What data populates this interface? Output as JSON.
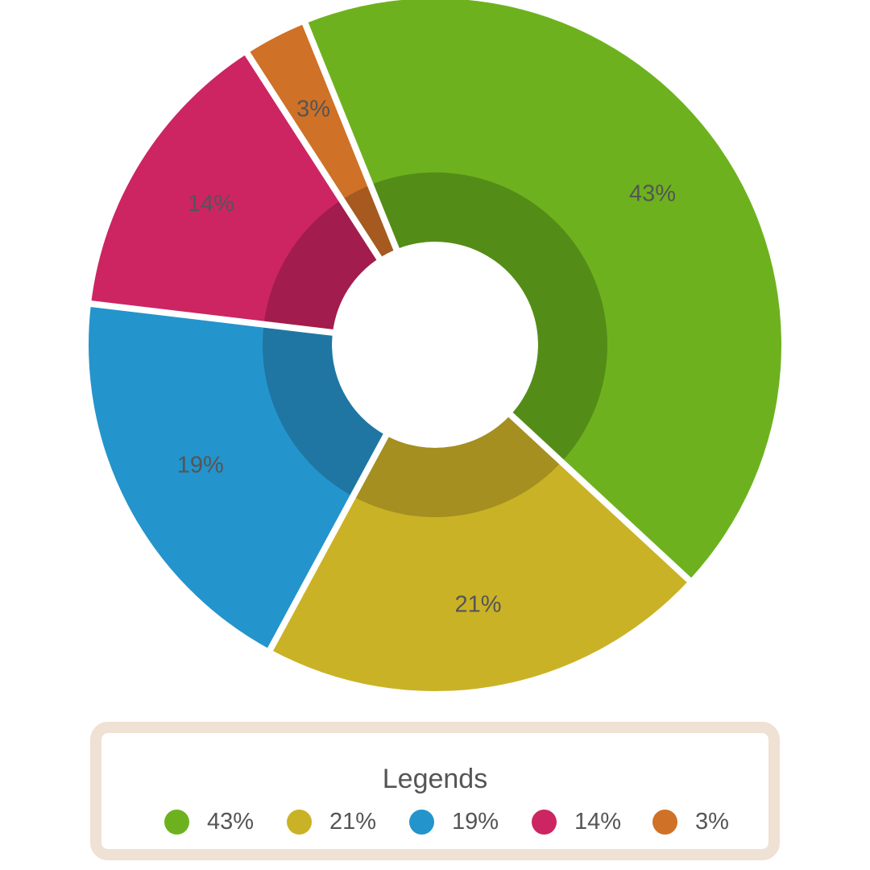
{
  "chart_data": {
    "type": "pie",
    "categories": [
      "43%",
      "21%",
      "19%",
      "14%",
      "3%"
    ],
    "values": [
      43,
      21,
      19,
      14,
      3
    ],
    "colors": [
      "#6db21e",
      "#cab226",
      "#2494cc",
      "#cc2562",
      "#cf7127"
    ],
    "inner_colors": [
      "#548c18",
      "#a48f20",
      "#1f76a2",
      "#a21c4d",
      "#a65a1f"
    ],
    "title": "",
    "legend": {
      "title": "Legends",
      "position": "bottom",
      "items": [
        "43%",
        "21%",
        "19%",
        "14%",
        "3%"
      ]
    }
  }
}
